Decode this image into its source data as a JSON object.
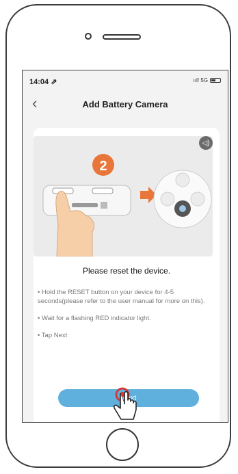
{
  "status_bar": {
    "time": "14:04 ⇗",
    "signal": "ııl! 5G"
  },
  "nav": {
    "title": "Add Battery Camera",
    "back_icon": "chevron-left-icon"
  },
  "illustration": {
    "step_number": "2"
  },
  "headline": "Please reset the device.",
  "instructions": [
    "• Hold the RESET button on your device for 4-5 seconds(please refer to the user manual for more on this).",
    "• Wait for a flashing RED indicator light.",
    "• Tap Next"
  ],
  "next_button": {
    "label": "Next"
  },
  "colors": {
    "accent": "#5fb0dd",
    "step_badge": "#e8763a",
    "arrow": "#e8763a"
  }
}
